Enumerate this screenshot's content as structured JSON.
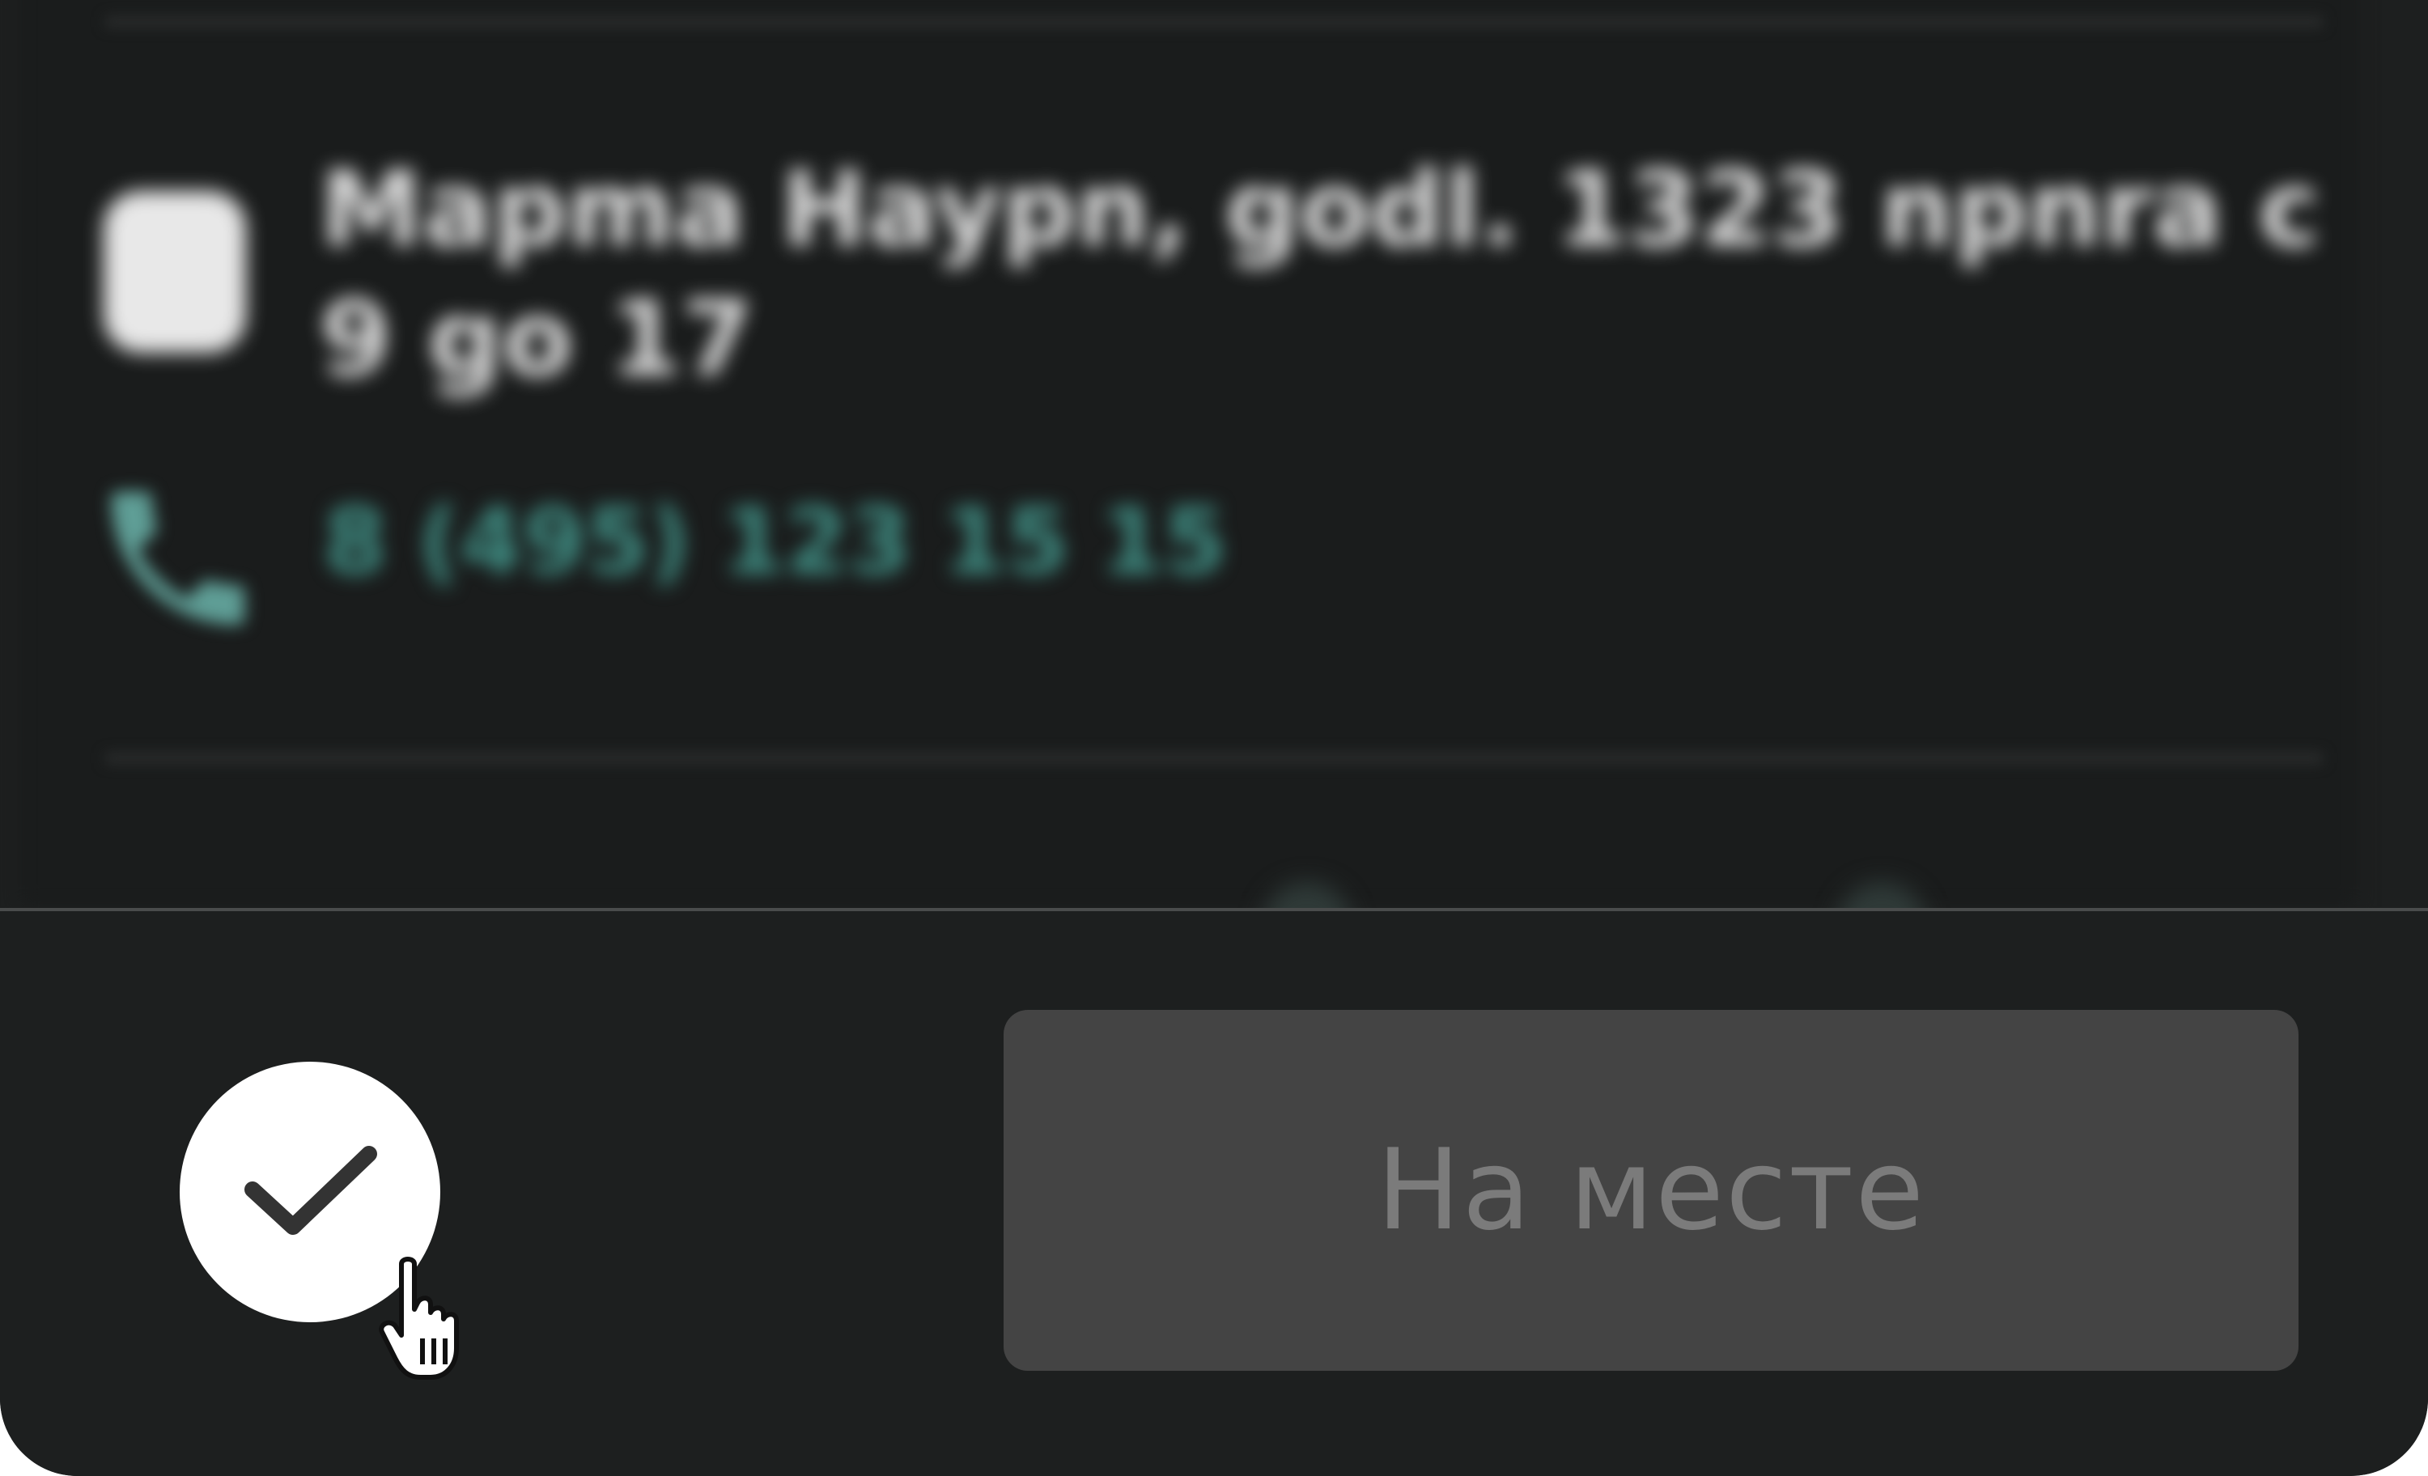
{
  "background_card": {
    "hours_text": "Mapma Haypn, godl. 1323 npnra c 9 go 17",
    "phone_text": "8 (495) 123 15 15"
  },
  "action_bar": {
    "confirm_icon": "check-icon",
    "primary_button_label": "На месте"
  },
  "colors": {
    "screen_bg": "#1d1f1f",
    "button_bg": "#444444",
    "button_text": "#7b7b7b",
    "phone_accent": "#3f8c82",
    "confirm_bg": "#ffffff"
  }
}
